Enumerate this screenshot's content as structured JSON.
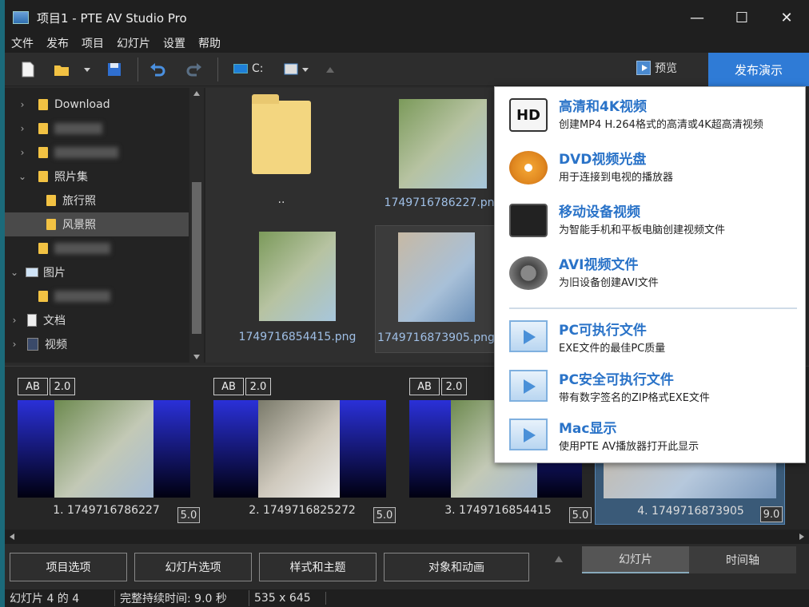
{
  "window": {
    "title": "项目1 - PTE AV Studio Pro",
    "minimize": "—",
    "maximize": "☐",
    "close": "✕"
  },
  "menu": [
    "文件",
    "发布",
    "项目",
    "幻灯片",
    "设置",
    "帮助"
  ],
  "toolbar": {
    "drive": "C:",
    "preview": "预览",
    "publish": "发布演示"
  },
  "tree": [
    {
      "label": "Download",
      "indent": 0,
      "expanded": false
    },
    {
      "label": "",
      "indent": 0,
      "expanded": false,
      "blurred": true
    },
    {
      "label": "",
      "indent": 0,
      "expanded": false,
      "blurred": true
    },
    {
      "label": "照片集",
      "indent": 0,
      "expanded": true
    },
    {
      "label": "旅行照",
      "indent": 1
    },
    {
      "label": "风景照",
      "indent": 1,
      "selected": true
    },
    {
      "label": "",
      "indent": 0,
      "blurred": true
    },
    {
      "label": "图片",
      "indent": 0,
      "expanded": true,
      "icon": "picture-icon"
    },
    {
      "label": "",
      "indent": 1,
      "blurred": true
    },
    {
      "label": "文档",
      "indent": 0,
      "icon": "document-icon"
    },
    {
      "label": "视频",
      "indent": 0,
      "icon": "video-icon"
    }
  ],
  "files": [
    {
      "name": "..",
      "type": "folder"
    },
    {
      "name": "1749716786227.png",
      "type": "image"
    },
    {
      "name": "1749716854415.png",
      "type": "image"
    },
    {
      "name": "1749716873905.png",
      "type": "image",
      "selected": true
    }
  ],
  "slides": [
    {
      "label": "1. 1749716786227",
      "ab": "AB",
      "transition": "2.0",
      "duration": "5.0"
    },
    {
      "label": "2. 1749716825272",
      "ab": "AB",
      "transition": "2.0",
      "duration": "5.0"
    },
    {
      "label": "3. 1749716854415",
      "ab": "AB",
      "transition": "2.0",
      "duration": "5.0"
    },
    {
      "label": "4. 1749716873905",
      "duration": "9.0",
      "selected": true
    }
  ],
  "bottom_buttons": [
    "项目选项",
    "幻灯片选项",
    "样式和主题",
    "对象和动画"
  ],
  "tabs": {
    "slides": "幻灯片",
    "timeline": "时间轴"
  },
  "status": {
    "slide": "幻灯片 4 的 4",
    "duration": "完整持续时间: 9.0 秒",
    "size": "535 x 645"
  },
  "publish_menu": [
    {
      "title": "高清和4K视频",
      "desc": "创建MP4 H.264格式的高清或4K超高清视频",
      "icon": "hd-icon"
    },
    {
      "title": "DVD视频光盘",
      "desc": "用于连接到电视的播放器",
      "icon": "dvd-icon"
    },
    {
      "title": "移动设备视频",
      "desc": "为智能手机和平板电脑创建视频文件",
      "icon": "mobile-devices-icon"
    },
    {
      "title": "AVI视频文件",
      "desc": "为旧设备创建AVI文件",
      "icon": "film-reel-icon"
    },
    {
      "title": "PC可执行文件",
      "desc": "EXE文件的最佳PC质量",
      "icon": "play-icon"
    },
    {
      "title": "PC安全可执行文件",
      "desc": "带有数字签名的ZIP格式EXE文件",
      "icon": "play-icon"
    },
    {
      "title": "Mac显示",
      "desc": "使用PTE AV播放器打开此显示",
      "icon": "play-icon"
    }
  ],
  "colors": {
    "accent": "#2f7bd6",
    "link": "#2a73c8",
    "folder": "#f2c243"
  }
}
